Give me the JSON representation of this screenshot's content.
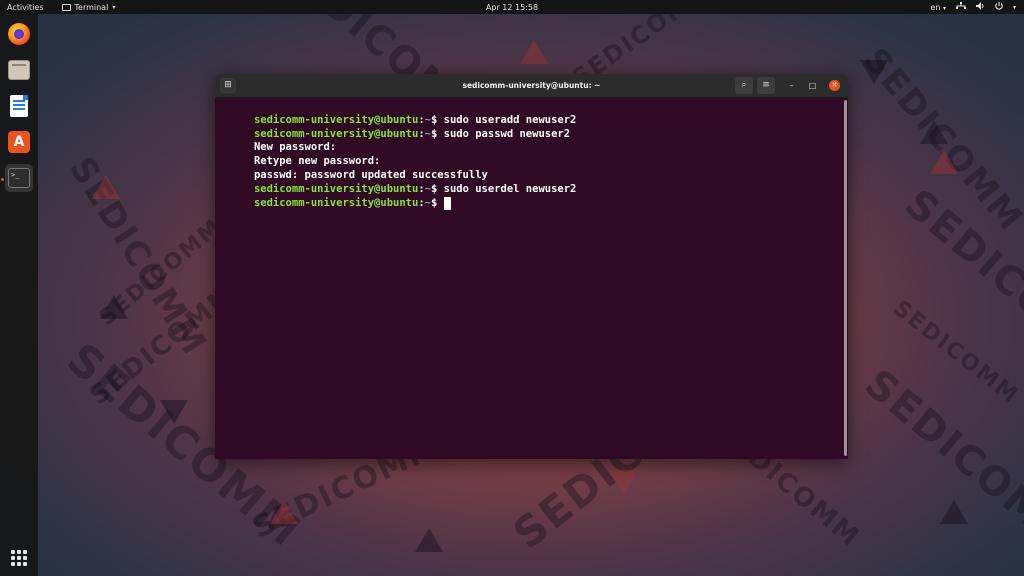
{
  "topbar": {
    "activities": "Activities",
    "app_name": "Terminal",
    "app_menu_caret": "▾",
    "clock": "Apr 12  15:58",
    "input_language": "en",
    "input_caret": "▾",
    "network_icon": "network-icon",
    "volume_icon": "volume-icon",
    "power_icon": "power-icon",
    "tray_caret": "▾"
  },
  "dock": {
    "items": [
      {
        "name": "firefox",
        "icon": "firefox-icon"
      },
      {
        "name": "files",
        "icon": "files-icon"
      },
      {
        "name": "libreoffice-writer",
        "icon": "writer-icon"
      },
      {
        "name": "ubuntu-software",
        "icon": "software-icon",
        "glyph": "A"
      },
      {
        "name": "terminal",
        "icon": "terminal-icon",
        "glyph": ">_",
        "active": true
      }
    ],
    "show_apps_icon": "apps-grid-icon"
  },
  "window": {
    "title": "sedicomm-university@ubuntu: ~",
    "new_tab_glyph": "⊞",
    "search_glyph": "⌕",
    "menu_glyph": "≡",
    "minimize_glyph": "–",
    "maximize_glyph": "□",
    "close_glyph": "✕"
  },
  "terminal": {
    "prompt_user": "sedicomm-university@ubuntu",
    "prompt_sep": ":",
    "prompt_path": "~",
    "prompt_sign": "$ ",
    "lines": [
      {
        "type": "command",
        "text": "sudo useradd newuser2"
      },
      {
        "type": "command",
        "text": "sudo passwd newuser2"
      },
      {
        "type": "output",
        "text": "New password:"
      },
      {
        "type": "output",
        "text": "Retype new password:"
      },
      {
        "type": "output",
        "text": "passwd: password updated successfully"
      },
      {
        "type": "command",
        "text": "sudo userdel newuser2"
      },
      {
        "type": "command",
        "text": ""
      }
    ]
  },
  "wallpaper": {
    "watermark_text": "SEDICOMM"
  },
  "colors": {
    "terminal_bg": "#300a24",
    "prompt_user": "#8ae234",
    "prompt_path": "#729fcf",
    "accent": "#e95420"
  }
}
